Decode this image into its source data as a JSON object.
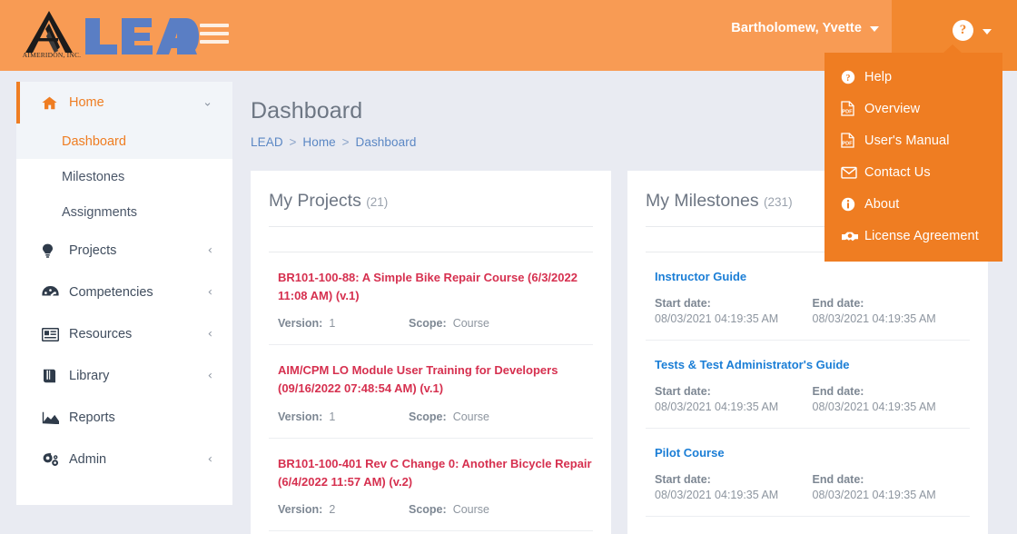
{
  "header": {
    "brand_word": "LEAD",
    "brand_sub": "AIMERIDON, INC.",
    "menu_icon": "hamburger-icon",
    "user_name": "Bartholomew, Yvette",
    "help_icon": "question-circle-icon"
  },
  "help_dropdown": {
    "items": [
      {
        "label": "Help",
        "icon": "question-circle-icon"
      },
      {
        "label": "Overview",
        "icon": "pdf-file-icon"
      },
      {
        "label": "User's Manual",
        "icon": "pdf-file-icon"
      },
      {
        "label": "Contact Us",
        "icon": "envelope-icon"
      },
      {
        "label": "About",
        "icon": "info-circle-icon"
      },
      {
        "label": "License Agreement",
        "icon": "handshake-icon"
      }
    ]
  },
  "sidebar": {
    "groups": [
      {
        "label": "Home",
        "icon": "home-icon",
        "active": true,
        "arrow": "⌄",
        "children": [
          {
            "label": "Dashboard",
            "active": true
          },
          {
            "label": "Milestones",
            "active": false
          },
          {
            "label": "Assignments",
            "active": false
          }
        ]
      },
      {
        "label": "Projects",
        "icon": "lightbulb-icon",
        "active": false,
        "arrow": "‹",
        "children": []
      },
      {
        "label": "Competencies",
        "icon": "gauge-icon",
        "active": false,
        "arrow": "‹",
        "children": []
      },
      {
        "label": "Resources",
        "icon": "id-card-icon",
        "active": false,
        "arrow": "‹",
        "children": []
      },
      {
        "label": "Library",
        "icon": "book-icon",
        "active": false,
        "arrow": "‹",
        "children": []
      },
      {
        "label": "Reports",
        "icon": "area-chart-icon",
        "active": false,
        "arrow": "",
        "children": []
      },
      {
        "label": "Admin",
        "icon": "gears-icon",
        "active": false,
        "arrow": "‹",
        "children": []
      }
    ]
  },
  "main": {
    "page_title": "Dashboard",
    "breadcrumb": {
      "items": [
        "LEAD",
        "Home",
        "Dashboard"
      ],
      "separator": ">"
    },
    "projects_card": {
      "title": "My Projects",
      "count": "(21)",
      "labels": {
        "version": "Version:",
        "scope": "Scope:"
      },
      "items": [
        {
          "name": "BR101-100-88: A Simple Bike Repair Course (6/3/2022 11:08 AM) (v.1)",
          "version": "1",
          "scope": "Course"
        },
        {
          "name": "AIM/CPM LO Module User Training for Developers (09/16/2022 07:48:54 AM) (v.1)",
          "version": "1",
          "scope": "Course"
        },
        {
          "name": "BR101-100-401 Rev C Change 0: Another Bicycle Repair (6/4/2022 11:57 AM) (v.2)",
          "version": "2",
          "scope": "Course"
        }
      ]
    },
    "milestones_card": {
      "title": "My Milestones",
      "count": "(231)",
      "labels": {
        "start": "Start date:",
        "end": "End date:"
      },
      "items": [
        {
          "name": "Instructor Guide",
          "start": "08/03/2021 04:19:35 AM",
          "end": "08/03/2021 04:19:35 AM"
        },
        {
          "name": "Tests & Test Administrator's Guide",
          "start": "08/03/2021 04:19:35 AM",
          "end": "08/03/2021 04:19:35 AM"
        },
        {
          "name": "Pilot Course",
          "start": "08/03/2021 04:19:35 AM",
          "end": "08/03/2021 04:19:35 AM"
        }
      ]
    }
  },
  "colors": {
    "header_orange": "#f89b54",
    "header_orange_dark": "#f2882f",
    "dropdown_orange": "#ef7d22",
    "accent_orange": "#ef7d22",
    "brand_blue": "#5a7ec4",
    "project_link_red": "#d6304f",
    "milestone_link_blue": "#1b7ed6",
    "page_bg": "#e9ebf2"
  }
}
